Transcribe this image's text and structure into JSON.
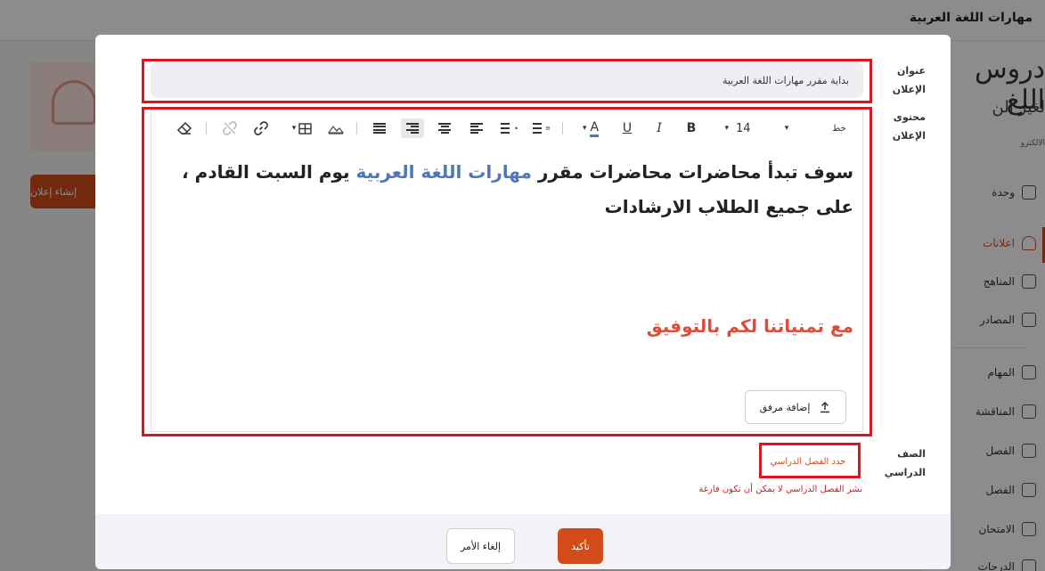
{
  "background": {
    "course_title": "مهارات اللغة العربية",
    "logo_text": "دروس اللغ",
    "logo_sub": "لغير الن",
    "logo_sub2": "الالكترو",
    "create_button": "إنشاء إعلان",
    "sidebar_items": [
      "وحدة",
      "اعلانات",
      "المناهج",
      "المصادر",
      "المهام",
      "المناقشة",
      "الفصل",
      "الفصل",
      "الامتحان",
      "الدرجات"
    ]
  },
  "modal": {
    "title_label": "عنوان الإعلان",
    "title_value": "بداية مقرر مهارات اللغة العربية",
    "content_label": "محتوى الإعلان",
    "toolbar": {
      "font_label": "خط",
      "font_size": "14",
      "bold": "B",
      "italic": "I",
      "underline": "U",
      "text_color": "A"
    },
    "content": {
      "part1": "سوف تبدأ محاضرات محاضرات مقرر ",
      "highlight": "مهارات اللغة العربية",
      "part2": " يوم السبت القادم ، على جميع الطلاب الارشادات",
      "closing": "مع تمنياتنا لكم بالتوفيق"
    },
    "attach_button": "إضافة مرفق",
    "semester_label": "الصف الدراسي",
    "semester_select": "حدد الفصل الدراسي",
    "semester_error": "نشر الفصل الدراسي لا يمكن أن تكون فارغة",
    "confirm_button": "تأكيد",
    "cancel_button": "إلغاء الأمر"
  },
  "colors": {
    "accent": "#d24b18",
    "highlight_border": "#e0141e",
    "link_blue": "#4f79b6",
    "closing_red": "#df4c3a"
  }
}
